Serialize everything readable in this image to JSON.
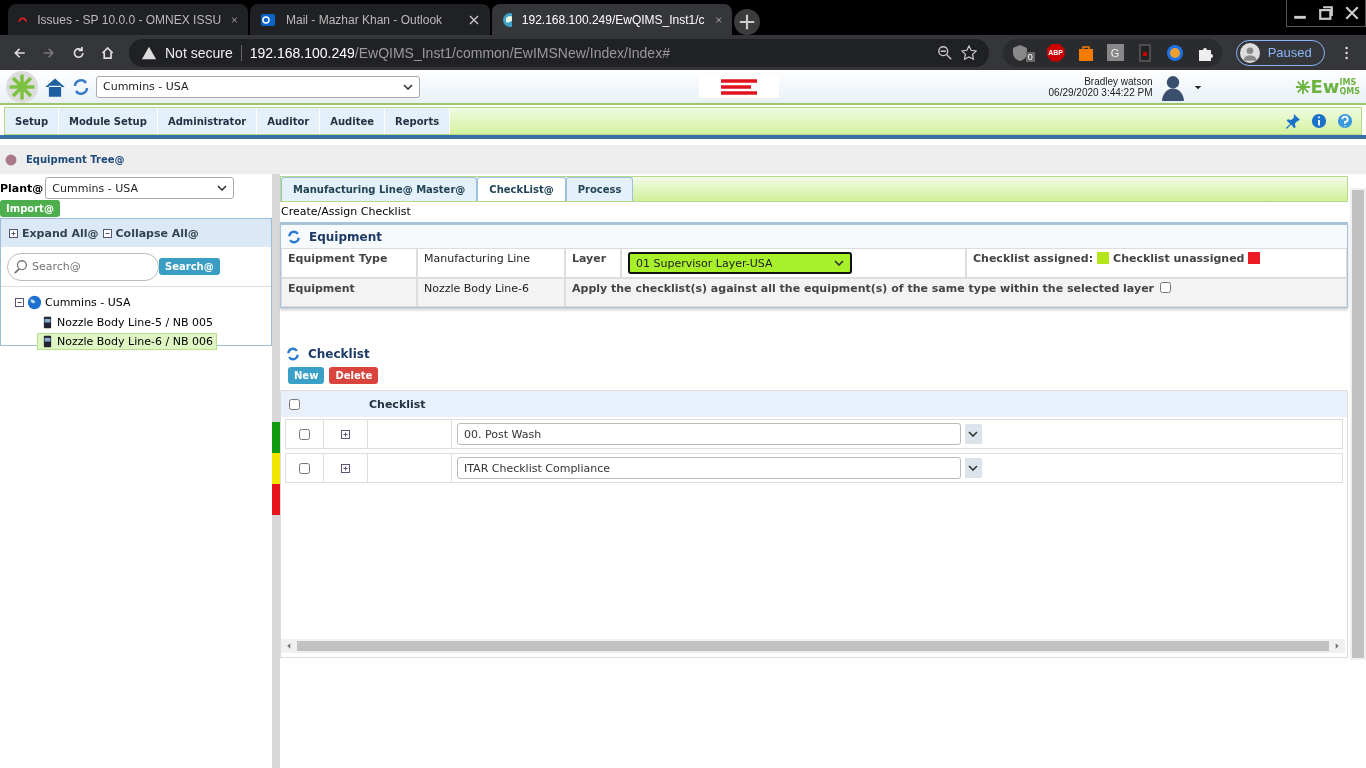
{
  "browser": {
    "tabs": [
      {
        "title": "Issues - SP 10.0.0 - OMNEX ISSU",
        "selected": false
      },
      {
        "title": "Mail - Mazhar Khan - Outlook",
        "selected": false
      },
      {
        "title": "192.168.100.249/EwQIMS_Inst1/c",
        "selected": true
      }
    ],
    "security": "Not secure",
    "host": "192.168.100.249",
    "path": "/EwQIMS_Inst1/common/EwIMSNew/Index/Index#",
    "extension_badge": "0",
    "extension_letter": "G",
    "abp": "ABP",
    "profile": "Paused"
  },
  "header": {
    "site": "Cummins - USA",
    "user": "Bradley watson",
    "datetime": "06/29/2020 3:44:22 PM",
    "logo": {
      "main": "Ew",
      "top": "IMS",
      "bottom": "QMS"
    }
  },
  "menu": [
    {
      "label": "Setup",
      "selected": false
    },
    {
      "label": "Module Setup",
      "selected": false
    },
    {
      "label": "Administrator",
      "selected": false
    },
    {
      "label": "Auditor",
      "selected": false
    },
    {
      "label": "Auditee",
      "selected": false
    },
    {
      "label": "Reports",
      "selected": false
    }
  ],
  "breadcrumb": "Equipment Tree@",
  "sidebar": {
    "plant_label": "Plant@",
    "plant": "Cummins - USA",
    "import": "Import@",
    "expand_all": "Expand All@",
    "collapse_all": "Collapse All@",
    "search_placeholder": "Search@",
    "search_button": "Search@",
    "tree": {
      "label": "Cummins - USA",
      "expanded": true,
      "children": [
        {
          "label": "Nozzle Body Line-5 / NB 005",
          "selected": false
        },
        {
          "label": "Nozzle Body Line-6 / NB 006",
          "selected": true
        }
      ]
    }
  },
  "status_bars": [
    {
      "color": "#0f9a0f"
    },
    {
      "color": "#f2e600"
    },
    {
      "color": "#e8141b"
    }
  ],
  "tabs": [
    {
      "label": "Manufacturing Line@ Master@",
      "selected": false
    },
    {
      "label": "CheckList@",
      "selected": true
    },
    {
      "label": "Process",
      "selected": false
    }
  ],
  "subtitle": "Create/Assign Checklist",
  "equipment": {
    "title": "Equipment",
    "type_label": "Equipment Type",
    "type": "Manufacturing Line",
    "layer_label": "Layer",
    "layer": "01 Supervisor Layer-USA",
    "legend": [
      {
        "label": "Checklist assigned:",
        "color": "#b5e61d"
      },
      {
        "label": "Checklist unassigned",
        "color": "#ed1c24"
      }
    ],
    "equipment_label": "Equipment",
    "equipment": "Nozzle Body Line-6",
    "apply_label": "Apply the checklist(s) against all the equipment(s) of the same type within the selected layer",
    "apply_checked": false
  },
  "checklist": {
    "title": "Checklist",
    "new": "New",
    "delete": "Delete",
    "column": "Checklist",
    "all_checked": false,
    "rows": [
      {
        "value": "00. Post Wash",
        "checked": false
      },
      {
        "value": "ITAR Checklist Compliance",
        "checked": false
      }
    ]
  }
}
